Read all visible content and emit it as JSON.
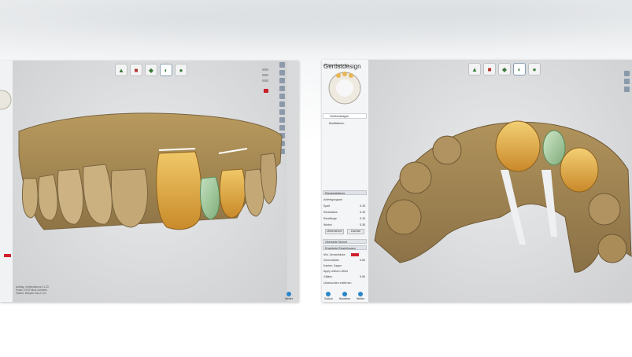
{
  "left_window": {
    "toolbar_icons": [
      "tooth-icon",
      "crown-icon",
      "gum-icon",
      "jaw-icon",
      "scan-icon"
    ],
    "footer_lines": [
      "Auftrag: Verblendkrone 21-23",
      "Praxis: TESTKlinik Zahnfeld",
      "Patient: Beispiel Lilla 21-23"
    ],
    "nav": [
      "Zurück",
      "Hinweise",
      "Weiter"
    ]
  },
  "right_window": {
    "panel_title": "Gerüstdesign",
    "panel_subtitle": "Verblendkappe 21",
    "items": [
      "Verblendkappe",
      "Modifizieren"
    ],
    "sections": {
      "randgestaltung": "Randgestaltung",
      "erweiterte": "Erweiterte Einstellungen",
      "oberflaeche": "Oberseite Stumpf"
    },
    "rows": [
      {
        "label": "Anfertigungsart",
        "value": ""
      },
      {
        "label": "Spalt",
        "value": "0.10"
      },
      {
        "label": "Randstärke",
        "value": "0.10"
      },
      {
        "label": "Randlänge",
        "value": "0.10"
      },
      {
        "label": "Winkel",
        "value": "0.30"
      }
    ],
    "ext_rows": [
      {
        "label": "Min. Zementdicke",
        "value": "0.00"
      },
      {
        "label": "Zementdicke",
        "value": "0.00"
      },
      {
        "label": "Kanten, Kappe",
        "value": ""
      },
      {
        "label": "Apply uniform offset",
        "value": ""
      },
      {
        "label": "Glätten",
        "value": "0.00"
      }
    ],
    "buttons": [
      "Umbenennen",
      "Löschen"
    ],
    "checkbox": "Untersichten entfernen",
    "footer_lines": [
      "Auftrag: Verblendkrone 21-23",
      "Praxis: TESTKlinik Zahnfeld",
      "Patient: Beispiel Lilla 21-23"
    ],
    "nav": [
      "Zurück",
      "Hinweise",
      "Weiter"
    ]
  },
  "colors": {
    "accent": "#2a86c8",
    "alert": "#d21f2b",
    "tooth": "#c8a766",
    "crown": "#e0a640",
    "green": "#9ec99a"
  }
}
